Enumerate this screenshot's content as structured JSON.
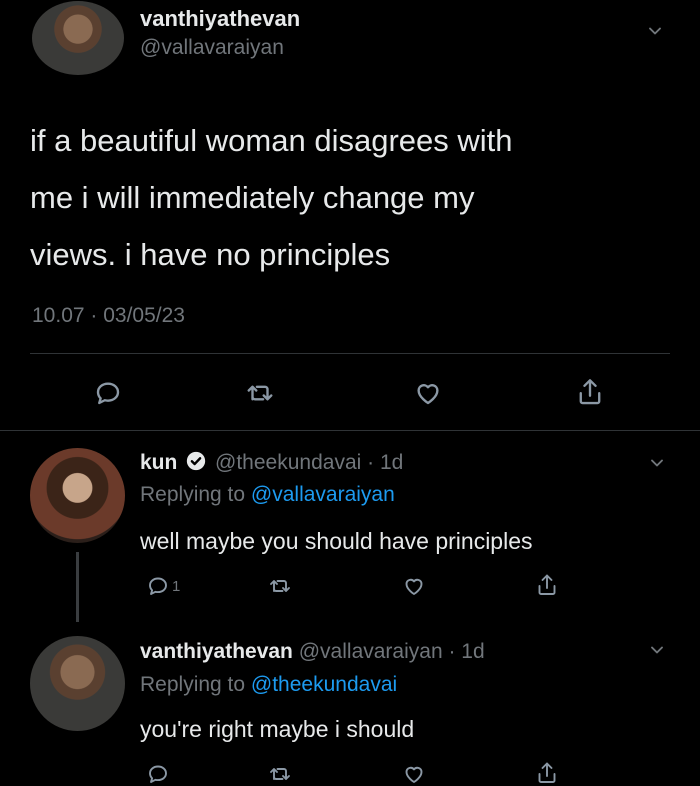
{
  "main_tweet": {
    "display_name": "vanthiyathevan",
    "handle": "@vallavaraiyan",
    "text_lines": [
      "if a beautiful woman disagrees with",
      "me i will immediately change my",
      "views. i have no principles"
    ],
    "timestamp": "10.07 · 03/05/23",
    "actions": [
      "reply-icon",
      "retweet-icon",
      "like-icon",
      "share-icon"
    ]
  },
  "replies": [
    {
      "display_name": "kun",
      "verified": true,
      "handle_time": "@theekundavai · 1d",
      "replying_prefix": "Replying to ",
      "replying_to": "@vallavaraiyan",
      "text": "well maybe you should have principles",
      "reply_count": "1"
    },
    {
      "display_name": "vanthiyathevan",
      "verified": false,
      "handle_time": "@vallavaraiyan · 1d",
      "replying_prefix": "Replying to ",
      "replying_to": "@theekundavai",
      "text": "you're right maybe i should",
      "reply_count": ""
    }
  ],
  "colors": {
    "background": "#000000",
    "text": "#e7e9ea",
    "muted": "#71767b",
    "link": "#1d9bf0",
    "divider": "#2f3336"
  }
}
